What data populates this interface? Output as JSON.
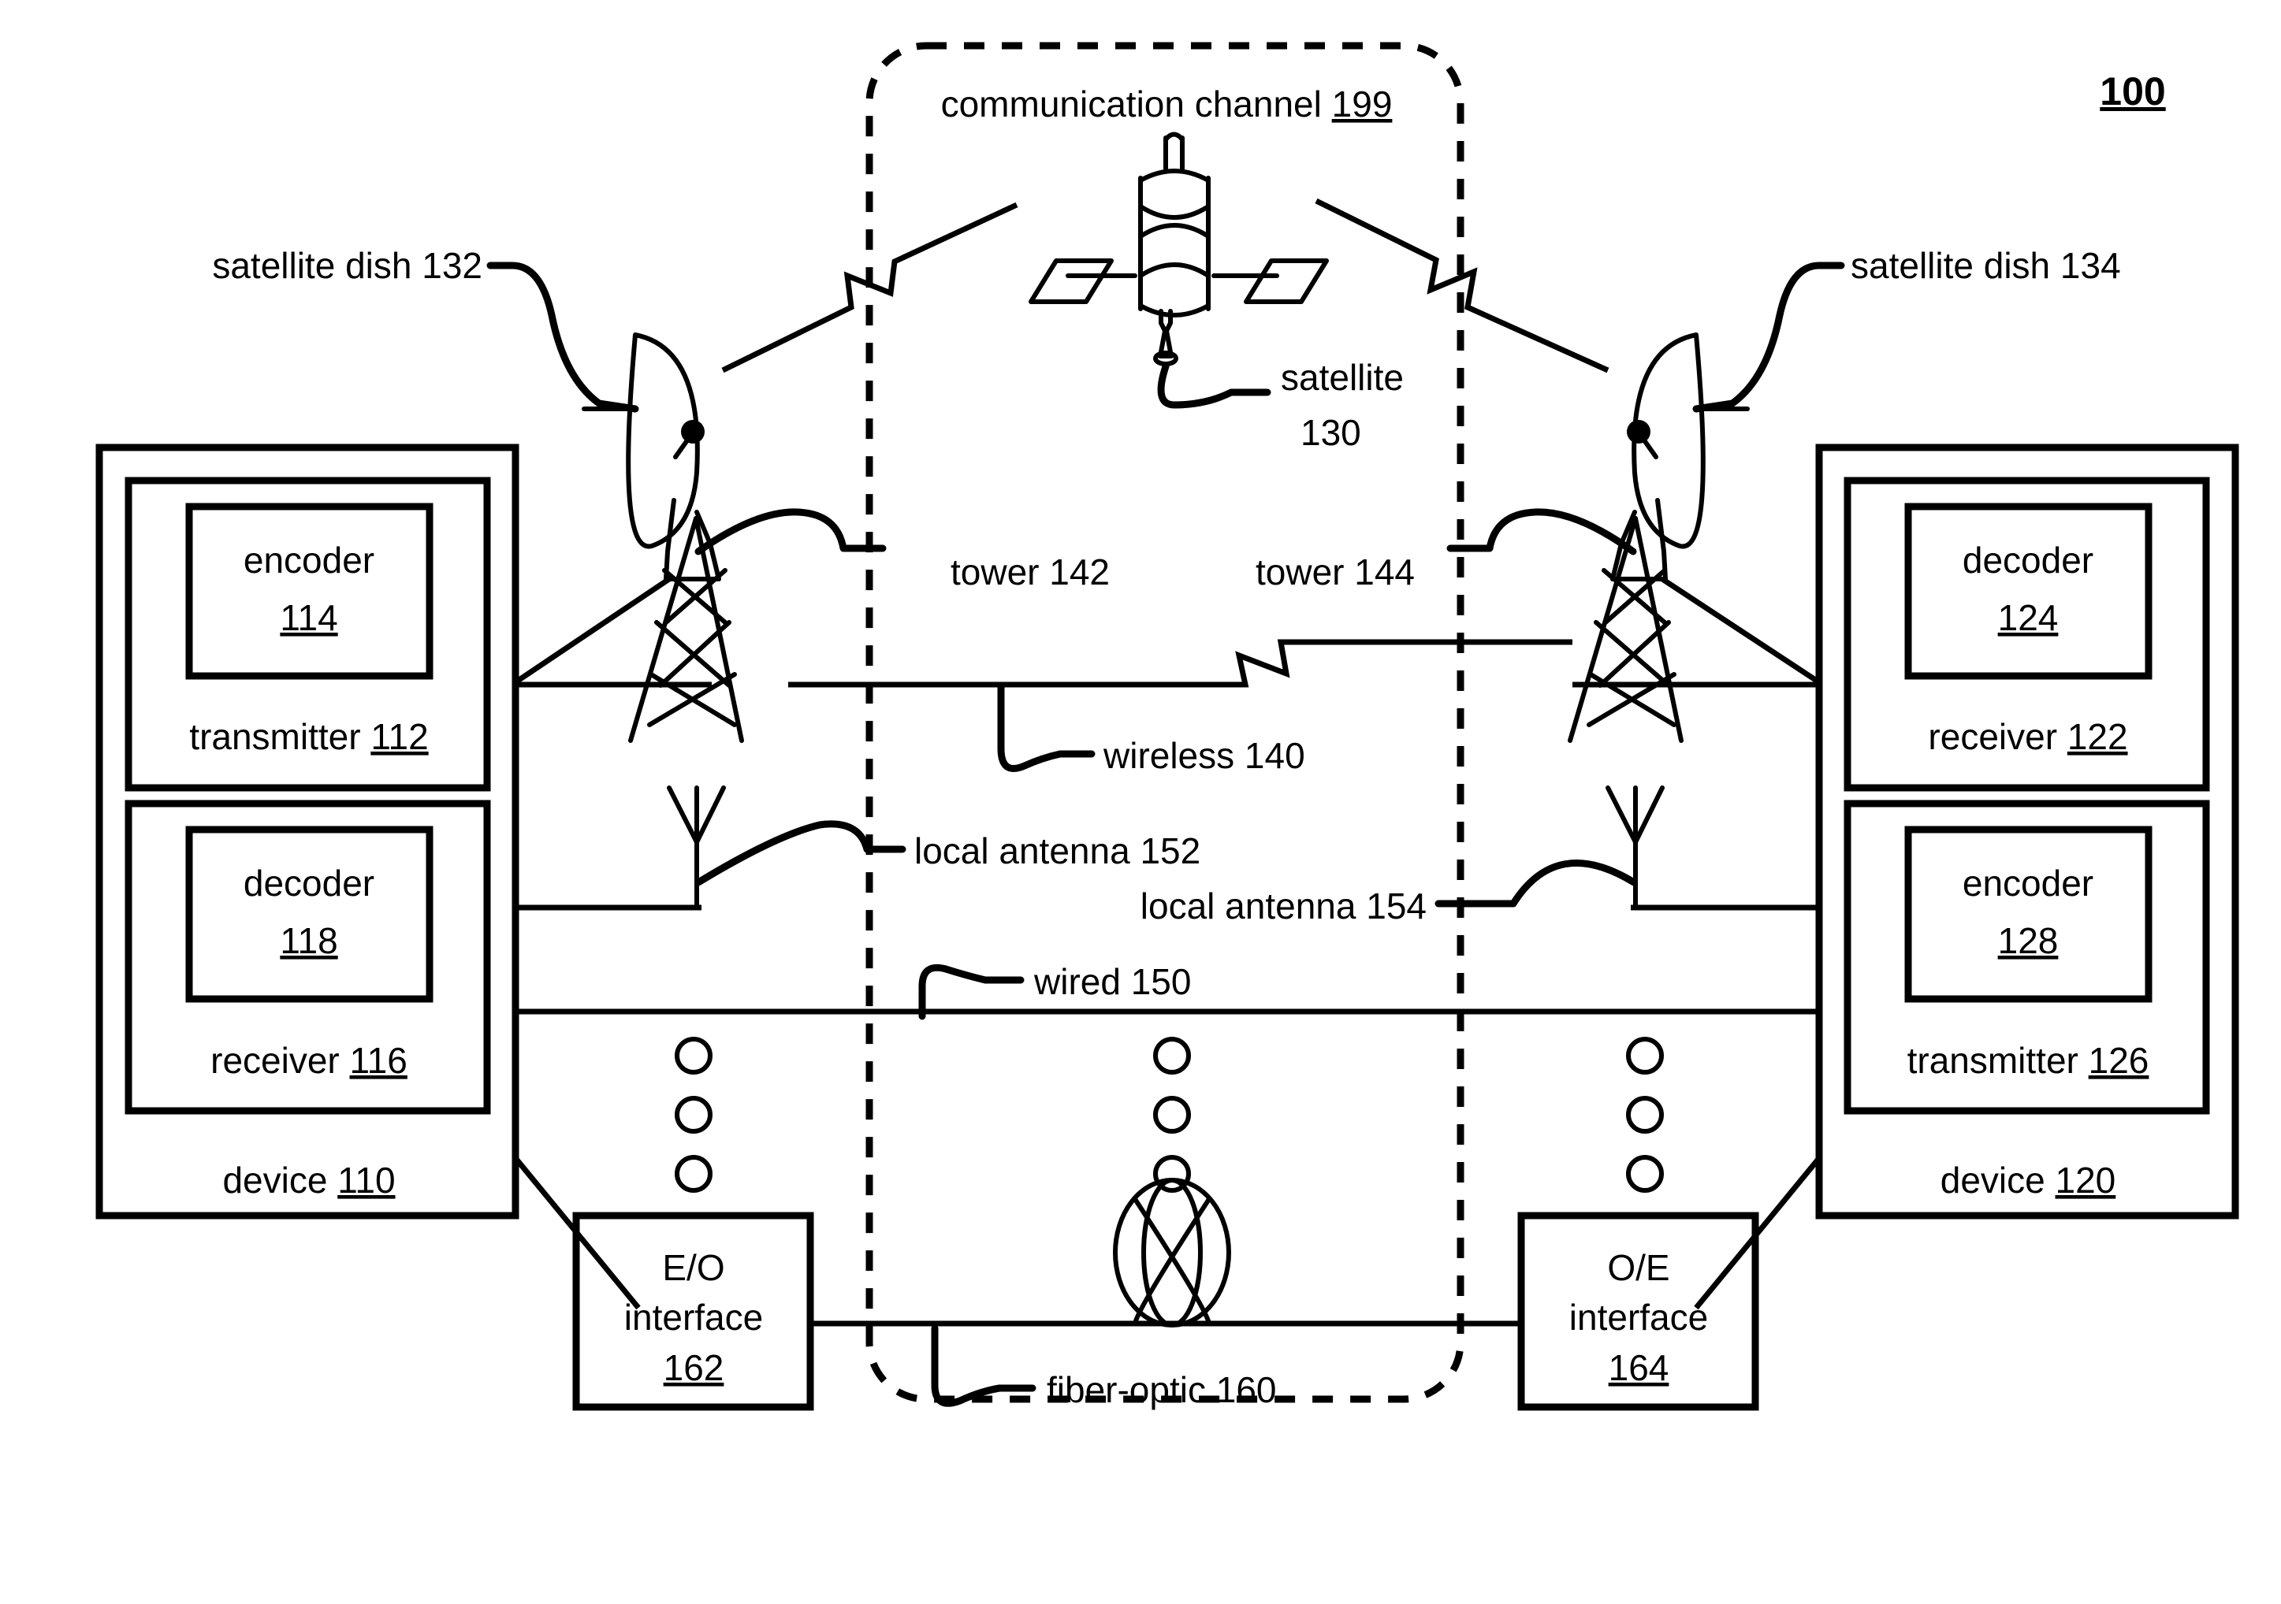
{
  "figure": {
    "number": "100",
    "type": "patent-figure"
  },
  "channel": {
    "label_text": "communication channel",
    "label_ref": "199"
  },
  "device_left": {
    "label_text": "device",
    "label_ref": "110",
    "transmitter": {
      "label_text": "transmitter",
      "label_ref": "112",
      "inner": {
        "label_text": "encoder",
        "label_ref": "114"
      }
    },
    "receiver": {
      "label_text": "receiver",
      "label_ref": "116",
      "inner": {
        "label_text": "decoder",
        "label_ref": "118"
      }
    }
  },
  "device_right": {
    "label_text": "device",
    "label_ref": "120",
    "receiver": {
      "label_text": "receiver",
      "label_ref": "122",
      "inner": {
        "label_text": "decoder",
        "label_ref": "124"
      }
    },
    "transmitter": {
      "label_text": "transmitter",
      "label_ref": "126",
      "inner": {
        "label_text": "encoder",
        "label_ref": "128"
      }
    }
  },
  "satellite_path": {
    "satellite": {
      "line1": "satellite",
      "line2": "130"
    },
    "dish_left": "satellite dish 132",
    "dish_right": "satellite dish 134"
  },
  "wireless_path": {
    "tower_left": "tower 142",
    "tower_right": "tower 144",
    "medium": "wireless 140"
  },
  "local_path": {
    "antenna_left": "local antenna 152",
    "antenna_right": "local antenna 154",
    "medium": "wired 150"
  },
  "fiber_path": {
    "medium": "fiber-optic 160",
    "interface_left": {
      "line1": "E/O",
      "line2": "interface",
      "ref": "162"
    },
    "interface_right": {
      "line1": "O/E",
      "line2": "interface",
      "ref": "164"
    }
  }
}
